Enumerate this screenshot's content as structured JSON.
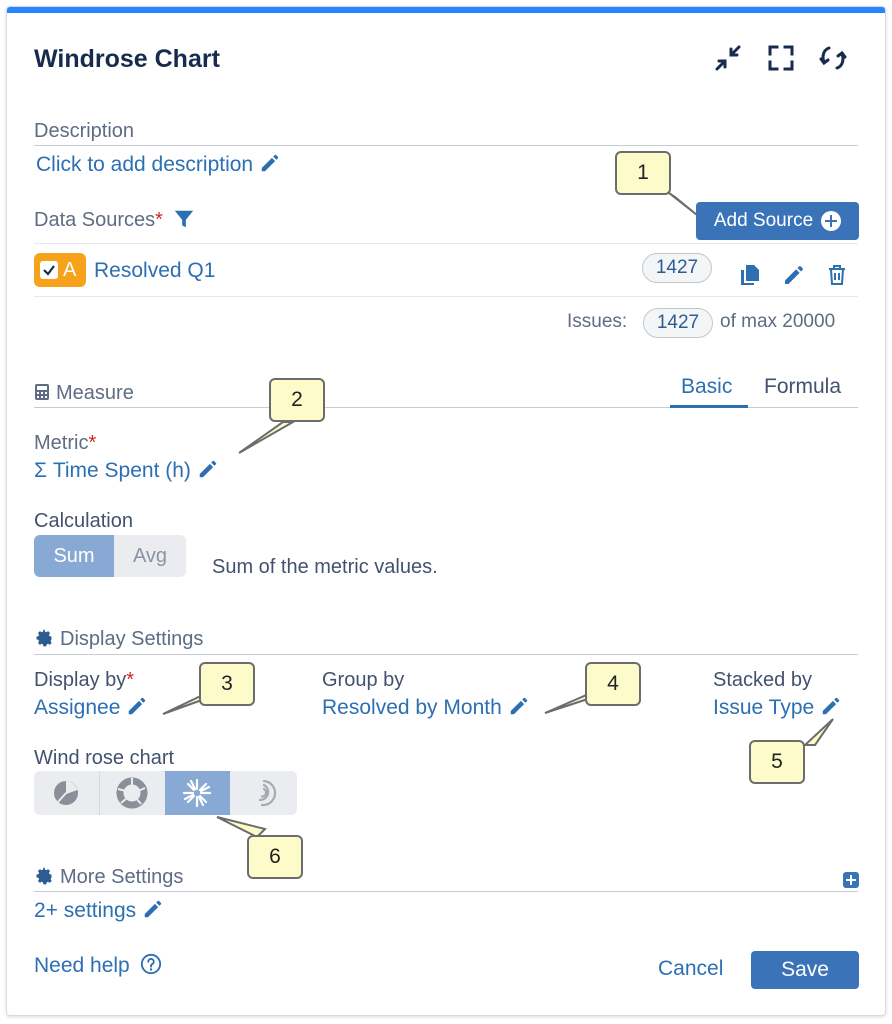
{
  "header": {
    "title": "Windrose Chart",
    "icons": [
      "collapse-icon",
      "fullscreen-icon",
      "refresh-icon"
    ]
  },
  "description": {
    "label": "Description",
    "link": "Click to add description"
  },
  "data_sources": {
    "label": "Data Sources",
    "required_mark": "*",
    "add_button": "Add Source",
    "source": {
      "badge_letter": "A",
      "name": "Resolved Q1",
      "count": "1427"
    },
    "issues_label": "Issues:",
    "issues_count": "1427",
    "issues_max": "of max 20000"
  },
  "measure": {
    "label": "Measure",
    "tabs": [
      {
        "label": "Basic",
        "active": true
      },
      {
        "label": "Formula",
        "active": false
      }
    ],
    "metric_label": "Metric",
    "metric_value": "Σ Time Spent (h)",
    "calculation_label": "Calculation",
    "calc_options": [
      {
        "label": "Sum",
        "active": true
      },
      {
        "label": "Avg",
        "active": false
      }
    ],
    "calc_description": "Sum of the metric values."
  },
  "display_settings": {
    "label": "Display Settings",
    "display_by_label": "Display by",
    "display_by_value": "Assignee",
    "group_by_label": "Group by",
    "group_by_value": "Resolved by Month",
    "stacked_by_label": "Stacked by",
    "stacked_by_value": "Issue Type",
    "chart_type_label": "Wind rose chart",
    "chart_types": [
      {
        "icon": "pie-chart-icon",
        "active": false
      },
      {
        "icon": "donut-chart-icon",
        "active": false
      },
      {
        "icon": "windrose-chart-icon",
        "active": true
      },
      {
        "icon": "radial-bar-chart-icon",
        "active": false
      }
    ]
  },
  "more_settings": {
    "label": "More Settings",
    "link": "2+ settings"
  },
  "footer": {
    "help": "Need help",
    "cancel": "Cancel",
    "save": "Save"
  },
  "callouts": [
    "1",
    "2",
    "3",
    "4",
    "5",
    "6"
  ],
  "colors": {
    "accent": "#2684ff",
    "primary_button": "#3b73b9",
    "link": "#2c6fb3",
    "badge": "#f7a21b",
    "callout_fill": "#fdfbc9"
  }
}
